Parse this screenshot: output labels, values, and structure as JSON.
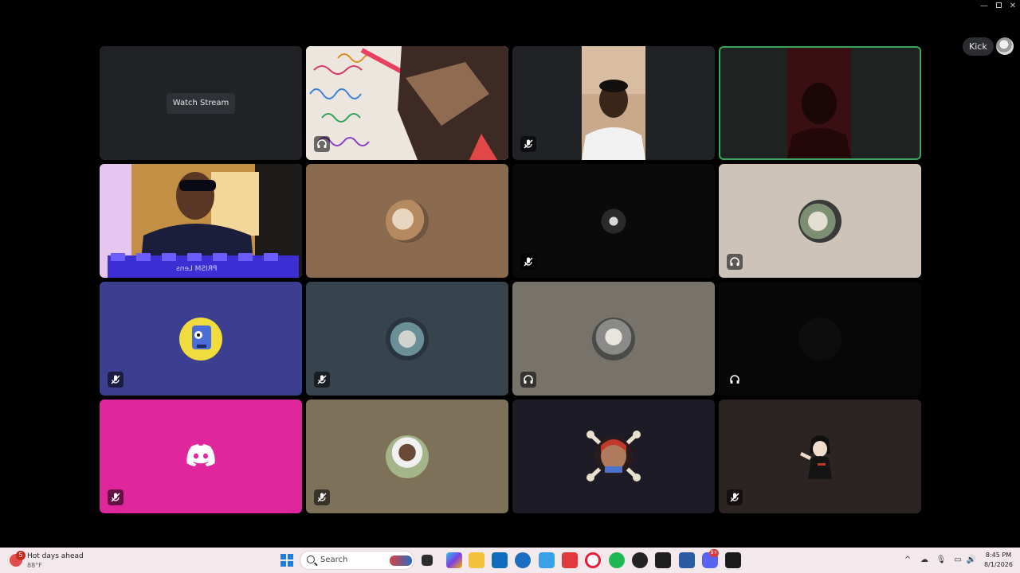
{
  "window": {
    "minimize_glyph": "—",
    "close_glyph": "✕"
  },
  "header": {
    "kick_label": "Kick"
  },
  "stage": {
    "watch_stream_label": "Watch Stream",
    "camera_caption": "PRISM Lens"
  },
  "colors": {
    "speaking_ring": "#3ba55d",
    "discord_pink": "#e0269c",
    "discord_indigo": "#3c3f8f",
    "taskbar_bg": "#f3e9ec"
  },
  "taskbar": {
    "weather_title": "Hot days ahead",
    "weather_temp": "88°F",
    "weather_badge": "5",
    "search_label": "Search",
    "clock_time": "8:45 PM",
    "clock_date": "8/1/2026",
    "discord_badge": "9+",
    "tray_chevron": "^"
  },
  "icons": {
    "mute": "microphone-muted-icon",
    "deafen": "headphones-icon",
    "discord": "discord-logo-icon"
  }
}
